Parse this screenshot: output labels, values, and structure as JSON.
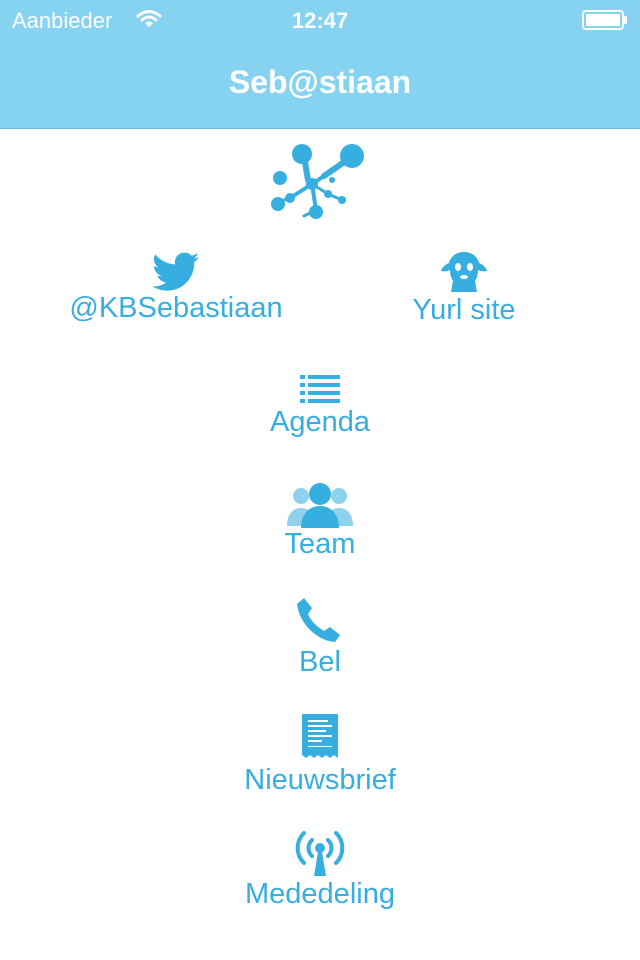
{
  "status_bar": {
    "carrier": "Aanbieder",
    "time": "12:47"
  },
  "nav": {
    "title": "Seb@stiaan"
  },
  "colors": {
    "bar": "#85d3f0",
    "accent": "#36aee0"
  },
  "links": {
    "twitter": {
      "label": "@KBSebastiaan",
      "icon": "twitter-bird-icon"
    },
    "yurl": {
      "label": "Yurl site",
      "icon": "yurl-mascot-icon"
    }
  },
  "menu": [
    {
      "label": "Agenda",
      "icon": "list-icon"
    },
    {
      "label": "Team",
      "icon": "team-icon"
    },
    {
      "label": "Bel",
      "icon": "phone-icon"
    },
    {
      "label": "Nieuwsbrief",
      "icon": "newsletter-icon"
    },
    {
      "label": "Mededeling",
      "icon": "broadcast-icon"
    }
  ]
}
